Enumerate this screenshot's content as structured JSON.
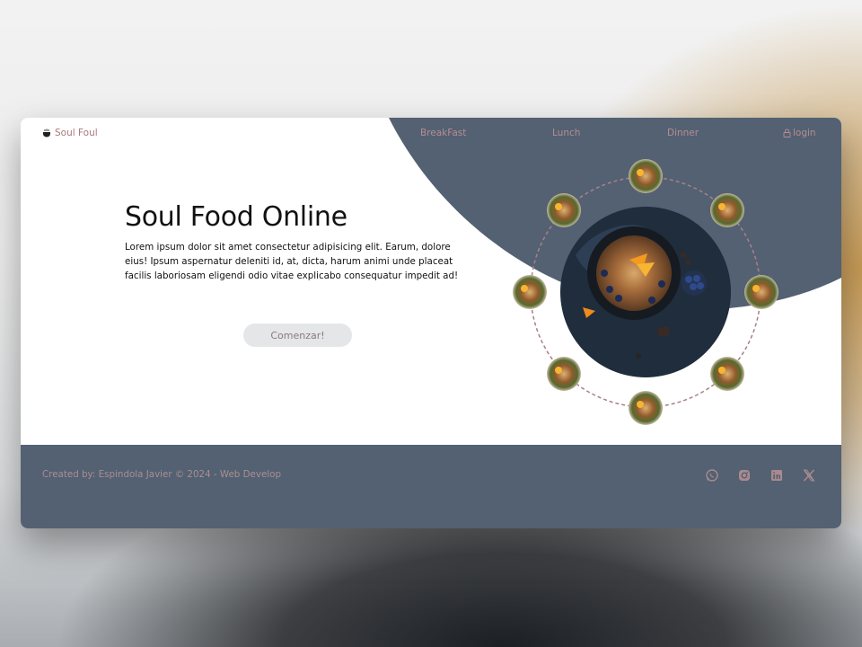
{
  "navbar": {
    "brand": "Soul Foul",
    "links": [
      "BreakFast",
      "Lunch",
      "Dinner"
    ],
    "login": "login"
  },
  "hero": {
    "title": "Soul Food Online",
    "text": "Lorem ipsum dolor sit amet consectetur adipisicing elit. Earum, dolore eius! Ipsum aspernatur deleniti id, at, dicta, harum animi unde placeat facilis laboriosam eligendi odio vitae explicabo consequatur impedit ad!",
    "cta": "Comenzar!"
  },
  "footer": {
    "credits": "Created by: Espindola Javier © 2024 - Web Develop",
    "social": [
      "whatsapp-icon",
      "instagram-icon",
      "linkedin-icon",
      "x-icon"
    ]
  },
  "colors": {
    "accent_dark": "#536172",
    "brand_text": "#a9777a",
    "orbit_dash": "#a98088"
  }
}
